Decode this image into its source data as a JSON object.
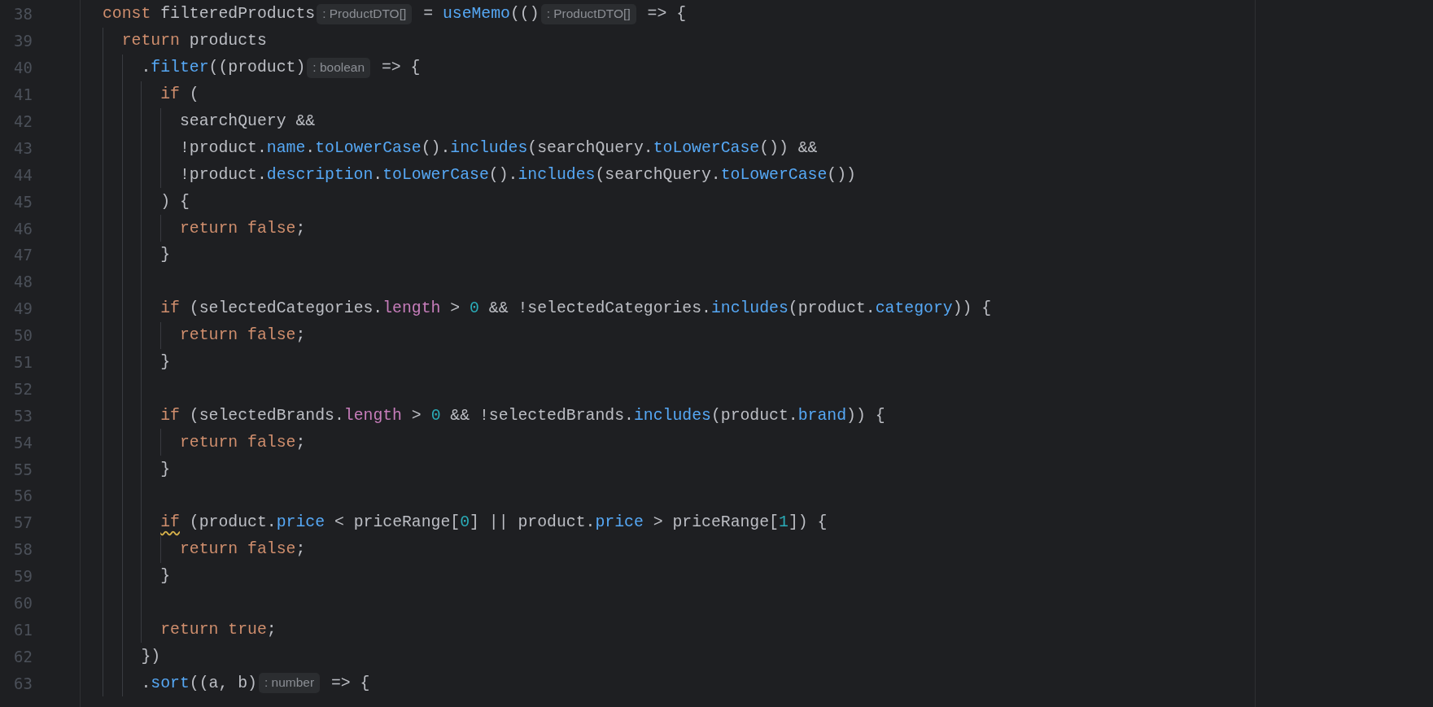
{
  "editor": {
    "lines": [
      {
        "number": "38",
        "tokens": [
          {
            "kind": "keyword",
            "text": "const"
          },
          {
            "kind": "plain",
            "text": " filteredProducts"
          },
          {
            "kind": "hint",
            "text": ": ProductDTO[]"
          },
          {
            "kind": "plain",
            "text": " = "
          },
          {
            "kind": "function",
            "text": "useMemo"
          },
          {
            "kind": "plain",
            "text": "(()"
          },
          {
            "kind": "hint",
            "text": ": ProductDTO[]"
          },
          {
            "kind": "plain",
            "text": " => {"
          }
        ]
      },
      {
        "number": "39",
        "tokens": [
          {
            "kind": "indent"
          },
          {
            "kind": "keyword",
            "text": "return"
          },
          {
            "kind": "plain",
            "text": " products"
          }
        ]
      },
      {
        "number": "40",
        "tokens": [
          {
            "kind": "indent"
          },
          {
            "kind": "indent"
          },
          {
            "kind": "plain",
            "text": "."
          },
          {
            "kind": "function",
            "text": "filter"
          },
          {
            "kind": "plain",
            "text": "((product)"
          },
          {
            "kind": "hint",
            "text": ": boolean"
          },
          {
            "kind": "plain",
            "text": " => {"
          }
        ]
      },
      {
        "number": "41",
        "tokens": [
          {
            "kind": "indent"
          },
          {
            "kind": "indent"
          },
          {
            "kind": "indent"
          },
          {
            "kind": "keyword",
            "text": "if"
          },
          {
            "kind": "plain",
            "text": " ("
          }
        ]
      },
      {
        "number": "42",
        "tokens": [
          {
            "kind": "indent"
          },
          {
            "kind": "indent"
          },
          {
            "kind": "indent"
          },
          {
            "kind": "indent"
          },
          {
            "kind": "plain",
            "text": "searchQuery &&"
          }
        ]
      },
      {
        "number": "43",
        "tokens": [
          {
            "kind": "indent"
          },
          {
            "kind": "indent"
          },
          {
            "kind": "indent"
          },
          {
            "kind": "indent"
          },
          {
            "kind": "plain",
            "text": "!product."
          },
          {
            "kind": "property",
            "text": "name"
          },
          {
            "kind": "plain",
            "text": "."
          },
          {
            "kind": "function",
            "text": "toLowerCase"
          },
          {
            "kind": "plain",
            "text": "()."
          },
          {
            "kind": "function",
            "text": "includes"
          },
          {
            "kind": "plain",
            "text": "(searchQuery."
          },
          {
            "kind": "function",
            "text": "toLowerCase"
          },
          {
            "kind": "plain",
            "text": "()) &&"
          }
        ]
      },
      {
        "number": "44",
        "tokens": [
          {
            "kind": "indent"
          },
          {
            "kind": "indent"
          },
          {
            "kind": "indent"
          },
          {
            "kind": "indent"
          },
          {
            "kind": "plain",
            "text": "!product."
          },
          {
            "kind": "property",
            "text": "description"
          },
          {
            "kind": "plain",
            "text": "."
          },
          {
            "kind": "function",
            "text": "toLowerCase"
          },
          {
            "kind": "plain",
            "text": "()."
          },
          {
            "kind": "function",
            "text": "includes"
          },
          {
            "kind": "plain",
            "text": "(searchQuery."
          },
          {
            "kind": "function",
            "text": "toLowerCase"
          },
          {
            "kind": "plain",
            "text": "())"
          }
        ]
      },
      {
        "number": "45",
        "tokens": [
          {
            "kind": "indent"
          },
          {
            "kind": "indent"
          },
          {
            "kind": "indent"
          },
          {
            "kind": "plain",
            "text": ") {"
          }
        ]
      },
      {
        "number": "46",
        "tokens": [
          {
            "kind": "indent"
          },
          {
            "kind": "indent"
          },
          {
            "kind": "indent"
          },
          {
            "kind": "indent"
          },
          {
            "kind": "keyword",
            "text": "return false"
          },
          {
            "kind": "plain",
            "text": ";"
          }
        ]
      },
      {
        "number": "47",
        "tokens": [
          {
            "kind": "indent"
          },
          {
            "kind": "indent"
          },
          {
            "kind": "indent"
          },
          {
            "kind": "plain",
            "text": "}"
          }
        ]
      },
      {
        "number": "48",
        "tokens": [
          {
            "kind": "indent"
          },
          {
            "kind": "indent"
          },
          {
            "kind": "indent"
          }
        ]
      },
      {
        "number": "49",
        "tokens": [
          {
            "kind": "indent"
          },
          {
            "kind": "indent"
          },
          {
            "kind": "indent"
          },
          {
            "kind": "keyword",
            "text": "if"
          },
          {
            "kind": "plain",
            "text": " (selectedCategories."
          },
          {
            "kind": "member",
            "text": "length"
          },
          {
            "kind": "plain",
            "text": " > "
          },
          {
            "kind": "number",
            "text": "0"
          },
          {
            "kind": "plain",
            "text": " && !selectedCategories."
          },
          {
            "kind": "function",
            "text": "includes"
          },
          {
            "kind": "plain",
            "text": "(product."
          },
          {
            "kind": "property",
            "text": "category"
          },
          {
            "kind": "plain",
            "text": ")) {"
          }
        ]
      },
      {
        "number": "50",
        "tokens": [
          {
            "kind": "indent"
          },
          {
            "kind": "indent"
          },
          {
            "kind": "indent"
          },
          {
            "kind": "indent"
          },
          {
            "kind": "keyword",
            "text": "return false"
          },
          {
            "kind": "plain",
            "text": ";"
          }
        ]
      },
      {
        "number": "51",
        "tokens": [
          {
            "kind": "indent"
          },
          {
            "kind": "indent"
          },
          {
            "kind": "indent"
          },
          {
            "kind": "plain",
            "text": "}"
          }
        ]
      },
      {
        "number": "52",
        "tokens": [
          {
            "kind": "indent"
          },
          {
            "kind": "indent"
          },
          {
            "kind": "indent"
          }
        ]
      },
      {
        "number": "53",
        "tokens": [
          {
            "kind": "indent"
          },
          {
            "kind": "indent"
          },
          {
            "kind": "indent"
          },
          {
            "kind": "keyword",
            "text": "if"
          },
          {
            "kind": "plain",
            "text": " (selectedBrands."
          },
          {
            "kind": "member",
            "text": "length"
          },
          {
            "kind": "plain",
            "text": " > "
          },
          {
            "kind": "number",
            "text": "0"
          },
          {
            "kind": "plain",
            "text": " && !selectedBrands."
          },
          {
            "kind": "function",
            "text": "includes"
          },
          {
            "kind": "plain",
            "text": "(product."
          },
          {
            "kind": "property",
            "text": "brand"
          },
          {
            "kind": "plain",
            "text": ")) {"
          }
        ]
      },
      {
        "number": "54",
        "tokens": [
          {
            "kind": "indent"
          },
          {
            "kind": "indent"
          },
          {
            "kind": "indent"
          },
          {
            "kind": "indent"
          },
          {
            "kind": "keyword",
            "text": "return false"
          },
          {
            "kind": "plain",
            "text": ";"
          }
        ]
      },
      {
        "number": "55",
        "tokens": [
          {
            "kind": "indent"
          },
          {
            "kind": "indent"
          },
          {
            "kind": "indent"
          },
          {
            "kind": "plain",
            "text": "}"
          }
        ]
      },
      {
        "number": "56",
        "tokens": [
          {
            "kind": "indent"
          },
          {
            "kind": "indent"
          },
          {
            "kind": "indent"
          }
        ]
      },
      {
        "number": "57",
        "tokens": [
          {
            "kind": "indent"
          },
          {
            "kind": "indent"
          },
          {
            "kind": "indent"
          },
          {
            "kind": "keyword",
            "text": "if",
            "warning": true
          },
          {
            "kind": "plain",
            "text": " (product."
          },
          {
            "kind": "property",
            "text": "price"
          },
          {
            "kind": "plain",
            "text": " < priceRange["
          },
          {
            "kind": "number",
            "text": "0"
          },
          {
            "kind": "plain",
            "text": "] || product."
          },
          {
            "kind": "property",
            "text": "price"
          },
          {
            "kind": "plain",
            "text": " > priceRange["
          },
          {
            "kind": "number",
            "text": "1"
          },
          {
            "kind": "plain",
            "text": "]) {"
          }
        ]
      },
      {
        "number": "58",
        "tokens": [
          {
            "kind": "indent"
          },
          {
            "kind": "indent"
          },
          {
            "kind": "indent"
          },
          {
            "kind": "indent"
          },
          {
            "kind": "keyword",
            "text": "return false"
          },
          {
            "kind": "plain",
            "text": ";"
          }
        ]
      },
      {
        "number": "59",
        "tokens": [
          {
            "kind": "indent"
          },
          {
            "kind": "indent"
          },
          {
            "kind": "indent"
          },
          {
            "kind": "plain",
            "text": "}"
          }
        ]
      },
      {
        "number": "60",
        "tokens": [
          {
            "kind": "indent"
          },
          {
            "kind": "indent"
          },
          {
            "kind": "indent"
          }
        ]
      },
      {
        "number": "61",
        "tokens": [
          {
            "kind": "indent"
          },
          {
            "kind": "indent"
          },
          {
            "kind": "indent"
          },
          {
            "kind": "keyword",
            "text": "return true"
          },
          {
            "kind": "plain",
            "text": ";"
          }
        ]
      },
      {
        "number": "62",
        "tokens": [
          {
            "kind": "indent"
          },
          {
            "kind": "indent"
          },
          {
            "kind": "plain",
            "text": "})"
          }
        ]
      },
      {
        "number": "63",
        "tokens": [
          {
            "kind": "indent"
          },
          {
            "kind": "indent"
          },
          {
            "kind": "plain",
            "text": "."
          },
          {
            "kind": "function",
            "text": "sort"
          },
          {
            "kind": "plain",
            "text": "((a, b)"
          },
          {
            "kind": "hint",
            "text": ": number"
          },
          {
            "kind": "plain",
            "text": " => {"
          }
        ]
      }
    ]
  }
}
